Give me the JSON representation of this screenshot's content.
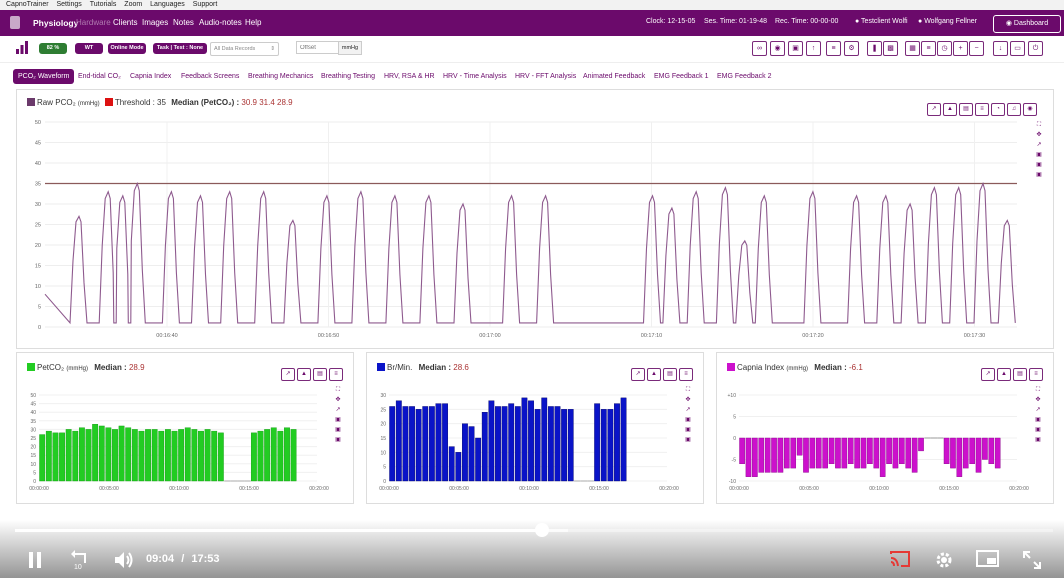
{
  "os_menu": [
    "CapnoTrainer",
    "Settings",
    "Tutorials",
    "Zoom",
    "Languages",
    "Support"
  ],
  "header": {
    "brand": "Physiology",
    "nav": [
      {
        "label": "Hardware",
        "dim": true
      },
      {
        "label": "Clients",
        "dim": false
      },
      {
        "label": "Images",
        "dim": false
      },
      {
        "label": "Notes",
        "dim": false
      },
      {
        "label": "Audio-notes",
        "dim": false
      },
      {
        "label": "Help",
        "dim": false
      }
    ],
    "clock": "Clock: 12-15-05",
    "ses_time": "Ses. Time: 01-19-48",
    "rec_time": "Rec. Time: 00-00-00",
    "client": "Testclient Wolfi",
    "user": "Wolfgang Fellner",
    "dashboard_label": "Dashboard"
  },
  "toolbar": {
    "battery": "82 %",
    "wt": "WT",
    "mode": "Online Mode",
    "task": "Task | Test : None",
    "records_select": "All Data Records",
    "offset_placeholder": "Offset",
    "unit": "mmHg",
    "colors": {
      "green": "#2e7d32",
      "purple": "#6b0a6b"
    }
  },
  "tabs": [
    "PCO₂ Waveform",
    "End-tidal CO₂",
    "Capnia Index",
    "Feedback Screens",
    "Breathing Mechanics",
    "Breathing Testing",
    "HRV, RSA & HR",
    "HRV - Time Analysis",
    "HRV - FFT Analysis",
    "Animated Feedback",
    "EMG Feedback 1",
    "EMG Feedback 2"
  ],
  "main_chart": {
    "legend": {
      "raw": "Raw PCO₂",
      "raw_unit": "(mmHg)",
      "threshold": "Threshold : 35",
      "median_label": "Median (PetCO₂) :",
      "median_values": [
        "30.9",
        "31.4",
        "28.9"
      ]
    }
  },
  "chart_data": [
    {
      "type": "line",
      "title": "Raw PCO₂ (mmHg)",
      "ylim": [
        0,
        50
      ],
      "yticks": [
        "0",
        "5",
        "10",
        "15",
        "20",
        "25",
        "30",
        "35",
        "40",
        "45",
        "50"
      ],
      "xticks": [
        "00:16:40",
        "00:16:50",
        "00:17:00",
        "00:17:10",
        "00:17:20",
        "00:17:30"
      ],
      "threshold": 35,
      "series_color": "#8e5a8e",
      "threshold_color": "#8b5a5a",
      "peaks": [
        {
          "t": 0.035,
          "peak": 27
        },
        {
          "t": 0.065,
          "peak": 33
        },
        {
          "t": 0.08,
          "peak": 32
        },
        {
          "t": 0.095,
          "peak": 35
        },
        {
          "t": 0.13,
          "peak": 33
        },
        {
          "t": 0.16,
          "peak": 32
        },
        {
          "t": 0.19,
          "peak": 33
        },
        {
          "t": 0.225,
          "peak": 33
        },
        {
          "t": 0.255,
          "peak": 26
        },
        {
          "t": 0.29,
          "peak": 32
        },
        {
          "t": 0.325,
          "peak": 33
        },
        {
          "t": 0.36,
          "peak": 32
        },
        {
          "t": 0.395,
          "peak": 32
        },
        {
          "t": 0.43,
          "peak": 30
        },
        {
          "t": 0.48,
          "peak": 32
        },
        {
          "t": 0.515,
          "peak": 32
        },
        {
          "t": 0.625,
          "peak": 32
        },
        {
          "t": 0.645,
          "peak": 29
        },
        {
          "t": 0.67,
          "peak": 33
        },
        {
          "t": 0.7,
          "peak": 34
        },
        {
          "t": 0.72,
          "peak": 21
        },
        {
          "t": 0.74,
          "peak": 32
        },
        {
          "t": 0.79,
          "peak": 33
        },
        {
          "t": 0.835,
          "peak": 32
        },
        {
          "t": 0.865,
          "peak": 32
        },
        {
          "t": 0.89,
          "peak": 30
        },
        {
          "t": 0.915,
          "peak": 34
        },
        {
          "t": 0.94,
          "peak": 34
        },
        {
          "t": 0.965,
          "peak": 35
        },
        {
          "t": 0.99,
          "peak": 26
        }
      ]
    },
    {
      "type": "bar",
      "title": "PetCO₂",
      "unit": "(mmHg)",
      "median_label": "Median :",
      "median": "28.9",
      "color": "#22cc22",
      "ylim": [
        0,
        50
      ],
      "yticks": [
        "0",
        "5",
        "10",
        "15",
        "20",
        "25",
        "30",
        "35",
        "40",
        "45",
        "50"
      ],
      "xticks": [
        "00:00:00",
        "00:05:00",
        "00:10:00",
        "00:15:00",
        "00:20:00"
      ],
      "values": [
        27,
        29,
        28,
        28,
        30,
        29,
        31,
        30,
        33,
        32,
        31,
        30,
        32,
        31,
        30,
        29,
        30,
        30,
        29,
        30,
        29,
        30,
        31,
        30,
        29,
        30,
        29,
        28,
        null,
        null,
        null,
        null,
        28,
        29,
        30,
        31,
        29,
        31,
        30
      ]
    },
    {
      "type": "bar",
      "title": "Br/Min.",
      "unit": "",
      "median_label": "Median :",
      "median": "28.6",
      "color": "#0a14c8",
      "ylim": [
        0,
        30
      ],
      "yticks": [
        "0",
        "5",
        "10",
        "15",
        "20",
        "25",
        "30"
      ],
      "xticks": [
        "00:00:00",
        "00:05:00",
        "00:10:00",
        "00:15:00",
        "00:20:00"
      ],
      "values": [
        26,
        28,
        26,
        26,
        25,
        26,
        26,
        27,
        27,
        12,
        10,
        20,
        19,
        15,
        24,
        28,
        26,
        26,
        27,
        26,
        29,
        28,
        25,
        29,
        26,
        26,
        25,
        25,
        null,
        null,
        null,
        27,
        25,
        25,
        27,
        29
      ]
    },
    {
      "type": "bar",
      "title": "Capnia Index",
      "unit": "(mmHg)",
      "median_label": "Median :",
      "median": "-6.1",
      "color": "#cc11cc",
      "ylim": [
        -10,
        10
      ],
      "yticks": [
        "+10",
        "5",
        "0",
        "-5",
        "-10"
      ],
      "xticks": [
        "00:00:00",
        "00:05:00",
        "00:10:00",
        "00:15:00",
        "00:20:00"
      ],
      "values": [
        -6,
        -9,
        -9,
        -8,
        -8,
        -8,
        -8,
        -7,
        -7,
        -4,
        -8,
        -7,
        -7,
        -7,
        -6,
        -7,
        -7,
        -6,
        -7,
        -7,
        -6,
        -7,
        -9,
        -6,
        -7,
        -6,
        -7,
        -8,
        -3,
        null,
        null,
        null,
        -6,
        -7,
        -9,
        -7,
        -6,
        -8,
        -5,
        -6,
        -7
      ]
    }
  ],
  "video": {
    "current": "09:04",
    "separator": "/",
    "duration": "17:53",
    "progress": 0.507,
    "cast_color": "#e53935"
  }
}
